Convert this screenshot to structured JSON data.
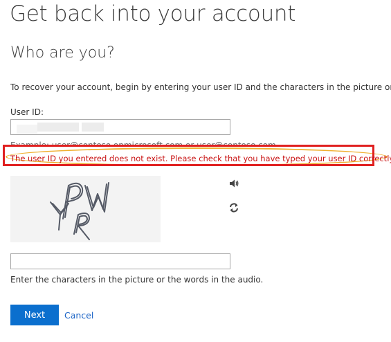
{
  "page": {
    "title": "Get back into your account",
    "section_title": "Who are you?",
    "instructions": "To recover your account, begin by entering your user ID and the characters in the picture or audio belo"
  },
  "userid": {
    "label": "User ID:",
    "value": "",
    "example_hint": "Example: user@contoso.onmicrosoft.com or user@contoso.com"
  },
  "error": {
    "message": "The user ID you entered does not exist. Please check that you have typed your user ID correctly.",
    "color": "#c81010"
  },
  "captcha": {
    "image_text": "PWYR",
    "audio_icon": "speaker-icon",
    "refresh_icon": "refresh-icon",
    "input_value": "",
    "hint": "Enter the characters in the picture or the words in the audio."
  },
  "actions": {
    "next_label": "Next",
    "cancel_label": "Cancel",
    "accent_color": "#0b6fce"
  }
}
